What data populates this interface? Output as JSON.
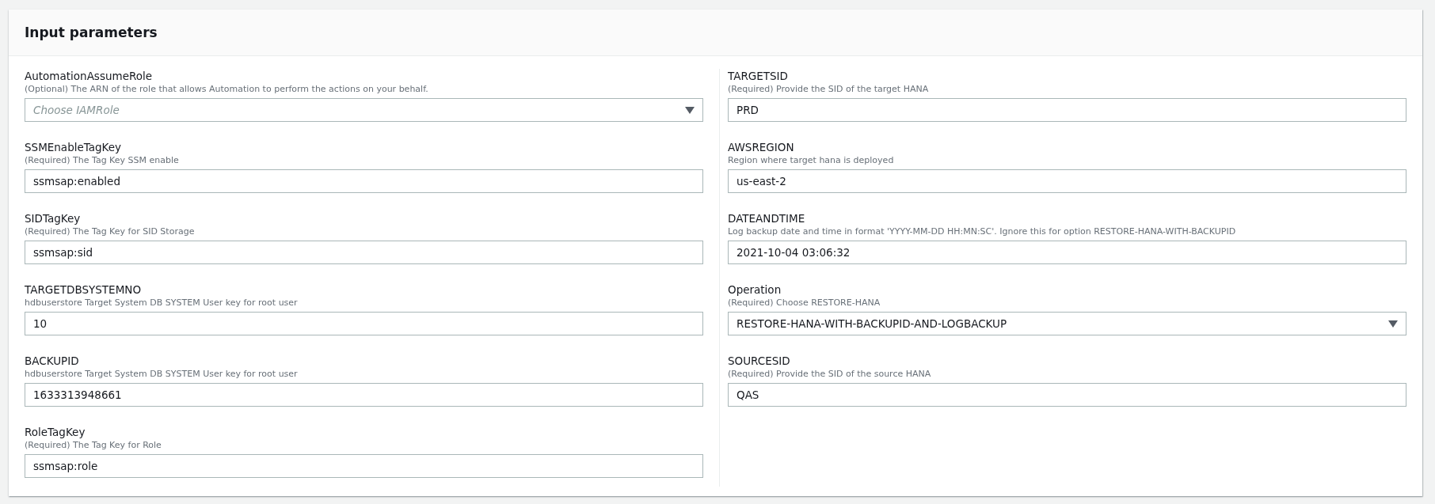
{
  "panel": {
    "title": "Input parameters"
  },
  "columns": [
    {
      "fields": [
        {
          "label": "AutomationAssumeRole",
          "help": "(Optional) The ARN of the role that allows Automation to perform the actions on your behalf.",
          "kind": "select",
          "placeholder": "Choose IAMRole"
        },
        {
          "label": "SSMEnableTagKey",
          "help": "(Required) The Tag Key SSM enable",
          "kind": "text",
          "value": "ssmsap:enabled"
        },
        {
          "label": "SIDTagKey",
          "help": "(Required) The Tag Key for SID Storage",
          "kind": "text",
          "value": "ssmsap:sid"
        },
        {
          "label": "TARGETDBSYSTEMNO",
          "help": "hdbuserstore Target System DB SYSTEM User key for root user",
          "kind": "text",
          "value": "10"
        },
        {
          "label": "BACKUPID",
          "help": "hdbuserstore Target System DB SYSTEM User key for root user",
          "kind": "text",
          "value": "1633313948661"
        },
        {
          "label": "RoleTagKey",
          "help": "(Required) The Tag Key for Role",
          "kind": "text",
          "value": "ssmsap:role"
        }
      ]
    },
    {
      "fields": [
        {
          "label": "TARGETSID",
          "help": "(Required) Provide the SID of the target HANA",
          "kind": "text",
          "value": "PRD"
        },
        {
          "label": "AWSREGION",
          "help": "Region where target hana is deployed",
          "kind": "text",
          "value": "us-east-2"
        },
        {
          "label": "DATEANDTIME",
          "help": "Log backup date and time in format 'YYYY-MM-DD HH:MN:SC'. Ignore this for option RESTORE-HANA-WITH-BACKUPID",
          "kind": "text",
          "value": "2021-10-04 03:06:32"
        },
        {
          "label": "Operation",
          "help": "(Required) Choose RESTORE-HANA",
          "kind": "select",
          "value": "RESTORE-HANA-WITH-BACKUPID-AND-LOGBACKUP"
        },
        {
          "label": "SOURCESID",
          "help": "(Required) Provide the SID of the source HANA",
          "kind": "text",
          "value": "QAS"
        }
      ]
    }
  ]
}
